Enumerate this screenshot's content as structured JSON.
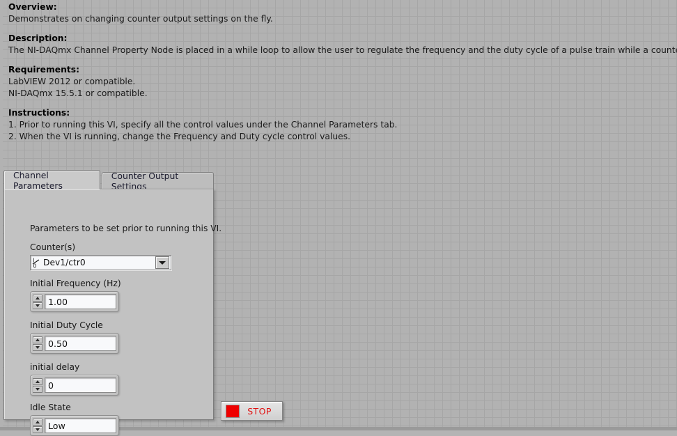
{
  "documentation": {
    "sections": [
      {
        "heading": "Overview:",
        "lines": [
          "Demonstrates on changing counter output settings on the fly."
        ]
      },
      {
        "heading": "Description:",
        "lines": [
          "The NI-DAQmx Channel Property Node is placed in a while loop to allow the user to regulate the frequency and the duty cycle of a pulse train while a counter output task is running."
        ]
      },
      {
        "heading": "Requirements:",
        "lines": [
          "LabVIEW 2012 or compatible.",
          "NI-DAQmx 15.5.1 or compatible."
        ]
      },
      {
        "heading": "Instructions:",
        "lines": [
          "1. Prior to running this VI, specify all the control values under the Channel Parameters tab.",
          "2. When the VI is running, change the Frequency and Duty cycle control values."
        ]
      }
    ]
  },
  "tab_control": {
    "tabs": [
      {
        "label": "Channel Parameters",
        "active": true
      },
      {
        "label": "Counter Output Settings",
        "active": false
      }
    ],
    "active_page": {
      "intro_text": "Parameters to be set prior to running this VI.",
      "controls": [
        {
          "label": "Counter(s)",
          "type": "io-combo",
          "value": "Dev1/ctr0",
          "icon": "io-name-icon",
          "dropdown_icon": "chevron-down-icon"
        },
        {
          "label": "Initial Frequency (Hz)",
          "type": "numeric-spinner",
          "value": "1.00"
        },
        {
          "label": "Initial Duty Cycle",
          "type": "numeric-spinner",
          "value": "0.50"
        },
        {
          "label": "initial delay",
          "type": "numeric-spinner",
          "value": "0"
        },
        {
          "label": "Idle State",
          "type": "numeric-spinner",
          "value": "Low"
        }
      ]
    }
  },
  "stop_button": {
    "label": "STOP",
    "led_icon": "square-led-icon",
    "led_color": "#EF0000",
    "text_color": "#E01010"
  },
  "theme": {
    "panel_background": "#B2B2B2",
    "grid_line": "#A6A6A6",
    "control_face": "#C2C2C2",
    "field_background": "#F8F9FB"
  }
}
